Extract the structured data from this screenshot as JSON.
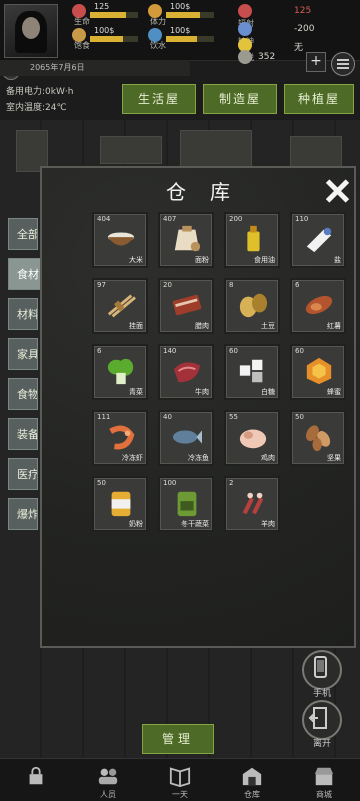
{
  "status": {
    "date": "2065年7月6日",
    "stats": [
      {
        "label": "生命",
        "value": "125",
        "fill": 0.75,
        "color": "#c84e4e"
      },
      {
        "label": "体力",
        "value": "100$",
        "fill": 0.7,
        "color": "#d29a3a"
      },
      {
        "label": "饱食",
        "value": "100$",
        "fill": 0.68,
        "color": "#c79a48"
      },
      {
        "label": "饮水",
        "value": "100$",
        "fill": 0.65,
        "color": "#4f8fc4"
      }
    ],
    "right": [
      {
        "label": "辐射",
        "value": "125",
        "color": "#c84e4e",
        "valueColor": "#d85c5c"
      },
      {
        "label": "精神",
        "value": "-200",
        "color": "#6a8fd0",
        "valueColor": "#d8d8d0"
      },
      {
        "label": "愉悦",
        "value": "无",
        "color": "#e3c33b",
        "valueColor": "#d8d8d0"
      },
      {
        "label": "",
        "value": "352",
        "color": "#9a9a90",
        "valueColor": "#d8d8d0"
      }
    ],
    "plus": "+"
  },
  "info": {
    "power": "备用电力:0kW·h",
    "temp": "室内温度:24℃"
  },
  "rooms": [
    "生活屋",
    "制造屋",
    "种植屋"
  ],
  "panel": {
    "title": "仓库",
    "items": [
      {
        "qty": "404",
        "name": "大米",
        "art": "bowl",
        "c1": "#e9e6dc",
        "c2": "#8a5a30"
      },
      {
        "qty": "407",
        "name": "面粉",
        "art": "sack",
        "c1": "#e8dcc4",
        "c2": "#b9915c"
      },
      {
        "qty": "200",
        "name": "食用油",
        "art": "bottle",
        "c1": "#e0c028",
        "c2": "#c28a18"
      },
      {
        "qty": "110",
        "name": "盐",
        "art": "salt",
        "c1": "#f2f2f2",
        "c2": "#5a7cc0"
      },
      {
        "qty": "97",
        "name": "挂面",
        "art": "noodle",
        "c1": "#d9b477",
        "c2": "#a37a3a"
      },
      {
        "qty": "20",
        "name": "腊肉",
        "art": "bacon",
        "c1": "#9e3d2a",
        "c2": "#e8c7b0"
      },
      {
        "qty": "8",
        "name": "土豆",
        "art": "potato",
        "c1": "#d8b055",
        "c2": "#a9802e"
      },
      {
        "qty": "6",
        "name": "红薯",
        "art": "yam",
        "c1": "#b4542e",
        "c2": "#d9874c"
      },
      {
        "qty": "6",
        "name": "青菜",
        "art": "greens",
        "c1": "#5bab2e",
        "c2": "#e2f0c8"
      },
      {
        "qty": "140",
        "name": "牛肉",
        "art": "beef",
        "c1": "#a2313a",
        "c2": "#e28a8e"
      },
      {
        "qty": "60",
        "name": "白糖",
        "art": "sugar",
        "c1": "#f3f3f3",
        "c2": "#bfbfbf"
      },
      {
        "qty": "60",
        "name": "蜂蜜",
        "art": "honey",
        "c1": "#e7902a",
        "c2": "#f5c24a"
      },
      {
        "qty": "111",
        "name": "冷冻虾",
        "art": "shrimp",
        "c1": "#e2703c",
        "c2": "#f2a878"
      },
      {
        "qty": "40",
        "name": "冷冻鱼",
        "art": "fish",
        "c1": "#5f7f9a",
        "c2": "#a7bccd"
      },
      {
        "qty": "55",
        "name": "鸡肉",
        "art": "chicken",
        "c1": "#f0c9b6",
        "c2": "#d69b83"
      },
      {
        "qty": "50",
        "name": "坚果",
        "art": "nuts",
        "c1": "#a86b3c",
        "c2": "#d09a64"
      },
      {
        "qty": "50",
        "name": "奶粉",
        "art": "can",
        "c1": "#e6ad34",
        "c2": "#f1f1f1"
      },
      {
        "qty": "100",
        "name": "冬干蔬菜",
        "art": "bag",
        "c1": "#6e9a36",
        "c2": "#3f5a1e"
      },
      {
        "qty": "2",
        "name": "羊肉",
        "art": "lamb",
        "c1": "#b5413e",
        "c2": "#f0d2c8"
      }
    ]
  },
  "categories": [
    {
      "label": "全部",
      "active": false
    },
    {
      "label": "食材",
      "active": true
    },
    {
      "label": "材料",
      "active": false
    },
    {
      "label": "家具",
      "active": false
    },
    {
      "label": "食物",
      "active": false
    },
    {
      "label": "装备",
      "active": false
    },
    {
      "label": "医疗",
      "active": false
    },
    {
      "label": "爆炸物",
      "active": false
    }
  ],
  "side_buttons": {
    "phone": "手机",
    "leave": "离开"
  },
  "manage": "管理",
  "bottom_nav": [
    {
      "label": "",
      "icon": "lock-icon"
    },
    {
      "label": "人员",
      "icon": "people-icon"
    },
    {
      "label": "一天",
      "icon": "book-icon"
    },
    {
      "label": "仓库",
      "icon": "warehouse-icon"
    },
    {
      "label": "商城",
      "icon": "shop-icon"
    }
  ]
}
